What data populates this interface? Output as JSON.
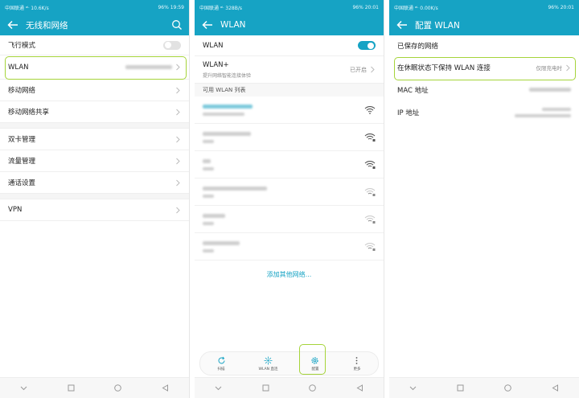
{
  "colors": {
    "accent": "#16a3c4",
    "highlight": "#a5d43a"
  },
  "screen1": {
    "status_left": "中国联通 ᵃᴸ 10.6K/s",
    "status_right": "96%  19:59",
    "title": "无线和网络",
    "airplane_label": "飞行模式",
    "airplane_toggle": "off",
    "wlan_label": "WLAN",
    "mobile_network": "移动网络",
    "tethering": "移动网络共享",
    "dual_sim": "双卡管理",
    "data_usage": "流量管理",
    "call_settings": "通话设置",
    "vpn": "VPN"
  },
  "screen2": {
    "status_left": "中国联通 ᵃᴸ 328B/s",
    "status_right": "96%  20:01",
    "title": "WLAN",
    "wlan_label": "WLAN",
    "wlan_toggle": "on",
    "wlanplus_title": "WLAN+",
    "wlanplus_sub": "提升网络智能连接体验",
    "wlanplus_status": "已开启",
    "available_header": "可用 WLAN 列表",
    "add_network": "添加其他网络...",
    "bottom_items": [
      {
        "icon": "refresh-icon",
        "label": "扫描"
      },
      {
        "icon": "wlan-direct-icon",
        "label": "WLAN 直连"
      },
      {
        "icon": "gear-icon",
        "label": "配置"
      },
      {
        "icon": "more-icon",
        "label": "更多"
      }
    ]
  },
  "screen3": {
    "status_left": "中国联通 ᵃᴸ 0.00K/s",
    "status_right": "96%  20:01",
    "title": "配置 WLAN",
    "saved_networks": "已保存的网络",
    "keep_wlan_sleep": "在休眠状态下保持 WLAN 连接",
    "keep_wlan_value": "仅限充电时",
    "mac_label": "MAC 地址",
    "ip_label": "IP 地址"
  }
}
